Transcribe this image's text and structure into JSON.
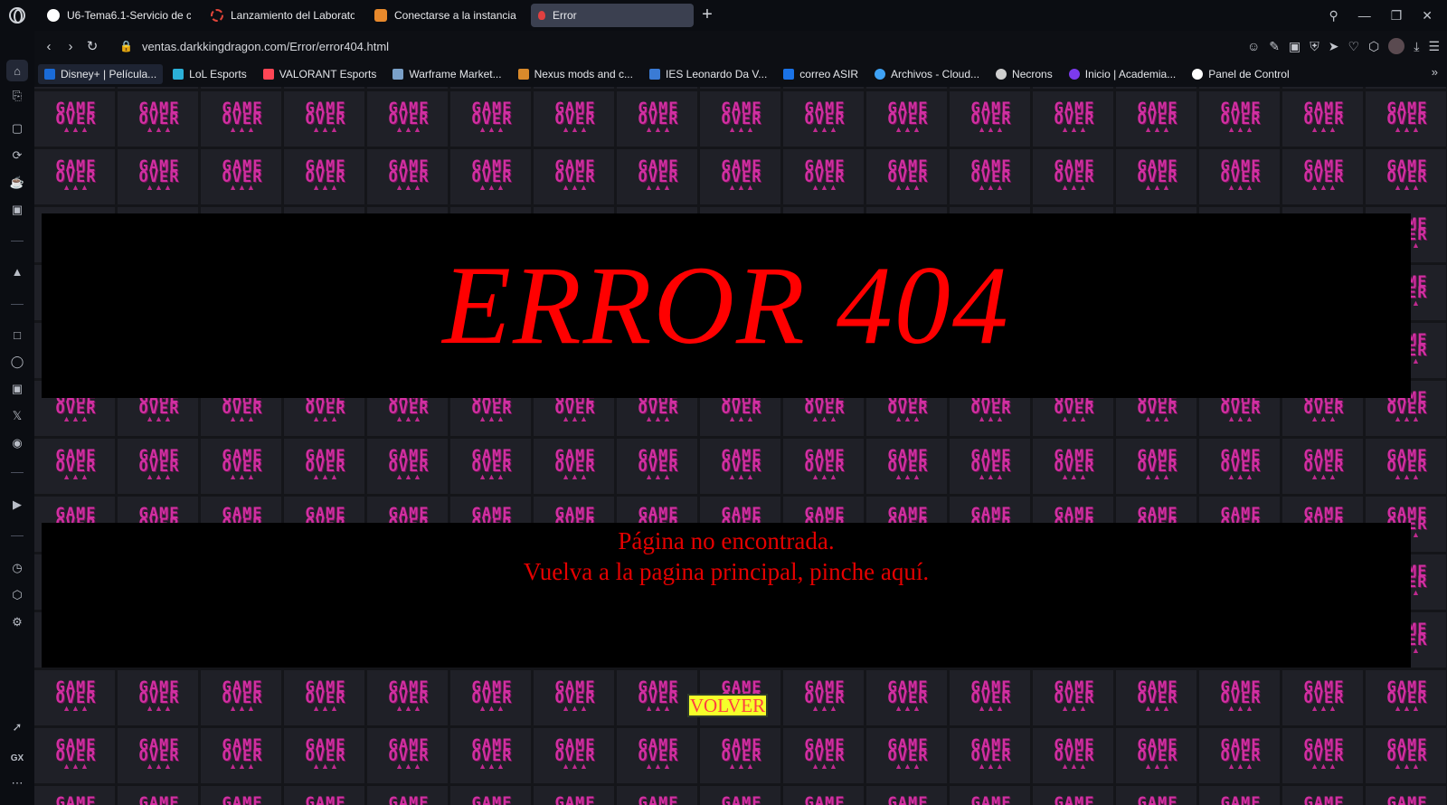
{
  "tabs": [
    {
      "label": "U6-Tema6.1-Servicio de c",
      "icon": "globe-icon",
      "color": "#ffffff"
    },
    {
      "label": "Lanzamiento del Laborator",
      "icon": "lab-icon",
      "color": "#e0453a"
    },
    {
      "label": "Conectarse a la instancia",
      "icon": "aws-icon",
      "color": "#e8892c"
    },
    {
      "label": "Error",
      "icon": "error-icon",
      "color": "#e04040",
      "active": true
    }
  ],
  "new_tab": "+",
  "address": {
    "url": "ventas.darkkingdragon.com/Error/error404.html"
  },
  "bookmarks": [
    {
      "label": "Disney+ | Película...",
      "color": "#1a6bd8"
    },
    {
      "label": "LoL Esports",
      "color": "#2bb0d8"
    },
    {
      "label": "VALORANT Esports",
      "color": "#ff4655"
    },
    {
      "label": "Warframe Market...",
      "color": "#7aa0c8"
    },
    {
      "label": "Nexus mods and c...",
      "color": "#d98a2b"
    },
    {
      "label": "IES Leonardo Da V...",
      "color": "#3a7bd5"
    },
    {
      "label": "correo ASIR",
      "color": "#1a73e8"
    },
    {
      "label": "Archivos - Cloud...",
      "color": "#3ea2f5"
    },
    {
      "label": "Necrons",
      "color": "#cfcfcf"
    },
    {
      "label": "Inicio | Academia...",
      "color": "#7c3aed"
    },
    {
      "label": "Panel de Control",
      "color": "#ffffff"
    }
  ],
  "sidebar_gx": "GX",
  "tile": {
    "line1": "GAME",
    "line2": "OVER",
    "invaders": "👾👾👾"
  },
  "content": {
    "title": "ERROR 404",
    "message_line1": "Página no encontrada.",
    "message_line2": "Vuelva a la pagina principal, pinche aquí.",
    "button_label": "VOLVER"
  },
  "colors": {
    "error_red": "#ff0000",
    "button_yellow": "#f5ff2a",
    "tile_pink": "#d12fa1"
  }
}
